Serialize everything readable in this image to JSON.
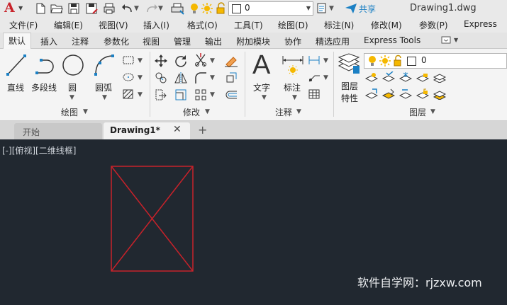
{
  "titlebar": {
    "app_letter": "A",
    "layer_value": "0",
    "share_label": "共享",
    "doc_title": "Drawing1.dwg"
  },
  "menu": [
    "文件(F)",
    "编辑(E)",
    "视图(V)",
    "插入(I)",
    "格式(O)",
    "工具(T)",
    "绘图(D)",
    "标注(N)",
    "修改(M)",
    "参数(P)",
    "Express"
  ],
  "ribbon_tabs": [
    "默认",
    "插入",
    "注释",
    "参数化",
    "视图",
    "管理",
    "输出",
    "附加模块",
    "协作",
    "精选应用",
    "Express Tools"
  ],
  "draw": {
    "line": "直线",
    "polyline": "多段线",
    "circle": "圆",
    "arc": "圆弧",
    "title": "绘图"
  },
  "modify": {
    "title": "修改"
  },
  "annotation": {
    "text": "文字",
    "dimension": "标注",
    "title": "注释"
  },
  "layers": {
    "properties_1": "图层",
    "properties_2": "特性",
    "current_layer": "0",
    "title": "图层"
  },
  "doc_tabs": {
    "start": "开始",
    "drawing": "Drawing1*"
  },
  "viewport": {
    "label": "[-][俯视][二维线框]"
  },
  "watermark": "软件自学网：rjzxw.com",
  "colors": {
    "accent": "#1b80c4",
    "drawing_line": "#c8222a",
    "canvas": "#212830",
    "app_red": "#c8222a"
  }
}
